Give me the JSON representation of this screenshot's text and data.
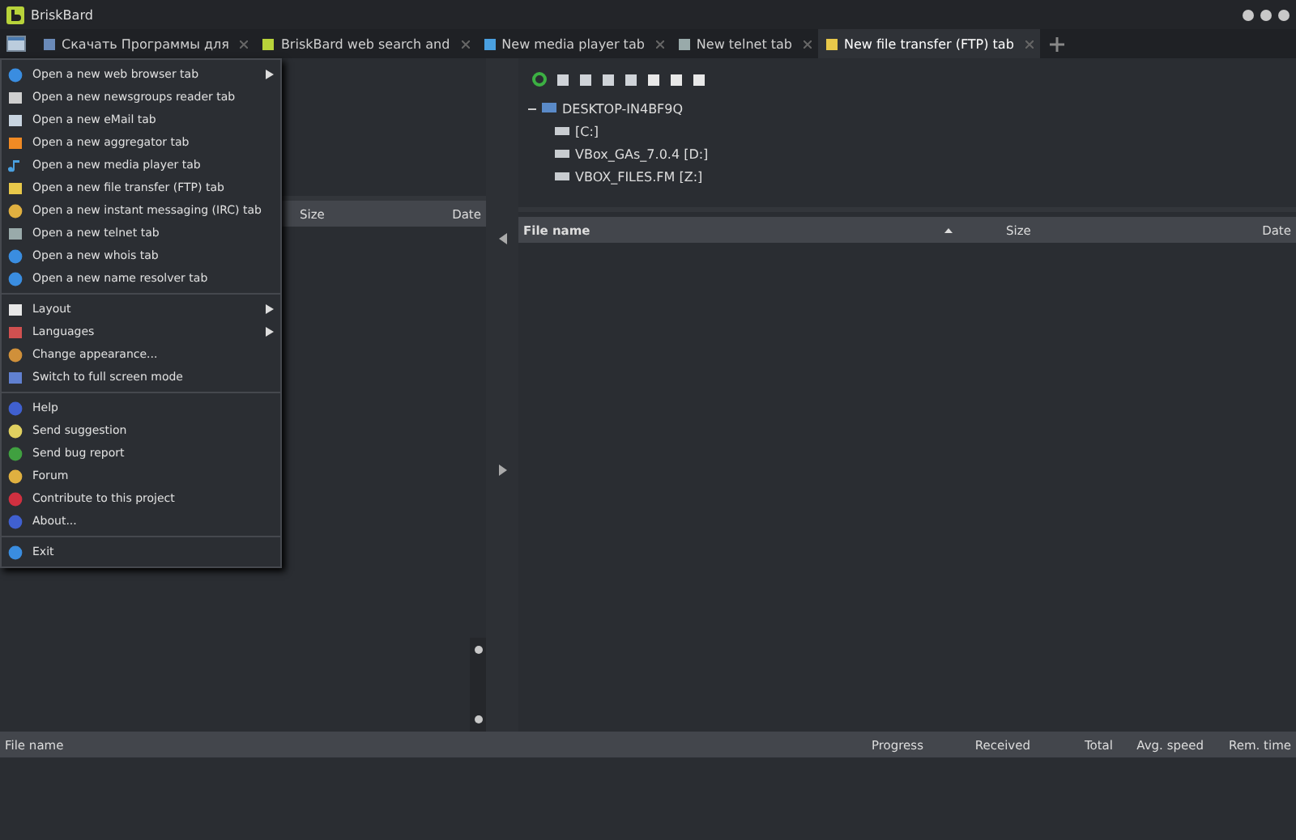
{
  "window": {
    "title": "BriskBard"
  },
  "tabs": [
    {
      "label": "Скачать Программы для",
      "selected": false
    },
    {
      "label": "BriskBard web search and",
      "selected": false
    },
    {
      "label": "New media player tab",
      "selected": false
    },
    {
      "label": "New telnet tab",
      "selected": false
    },
    {
      "label": "New file transfer (FTP) tab",
      "selected": true
    }
  ],
  "menu": {
    "items": [
      {
        "kind": "item",
        "label": "Open a new web browser tab",
        "submenu": true
      },
      {
        "kind": "item",
        "label": "Open a new newsgroups reader tab",
        "submenu": false
      },
      {
        "kind": "item",
        "label": "Open a new eMail tab",
        "submenu": false
      },
      {
        "kind": "item",
        "label": "Open a new aggregator tab",
        "submenu": false
      },
      {
        "kind": "item",
        "label": "Open a new media player tab",
        "submenu": false
      },
      {
        "kind": "item",
        "label": "Open a new file transfer (FTP) tab",
        "submenu": false
      },
      {
        "kind": "item",
        "label": "Open a new instant messaging (IRC) tab",
        "submenu": false
      },
      {
        "kind": "item",
        "label": "Open a new telnet tab",
        "submenu": false
      },
      {
        "kind": "item",
        "label": "Open a new whois tab",
        "submenu": false
      },
      {
        "kind": "item",
        "label": "Open a new name resolver tab",
        "submenu": false
      },
      {
        "kind": "separator"
      },
      {
        "kind": "item",
        "label": "Layout",
        "submenu": true
      },
      {
        "kind": "item",
        "label": "Languages",
        "submenu": true
      },
      {
        "kind": "item",
        "label": "Change appearance...",
        "submenu": false
      },
      {
        "kind": "item",
        "label": "Switch to full screen mode",
        "submenu": false
      },
      {
        "kind": "separator"
      },
      {
        "kind": "item",
        "label": "Help",
        "submenu": false
      },
      {
        "kind": "item",
        "label": "Send suggestion",
        "submenu": false
      },
      {
        "kind": "item",
        "label": "Send bug report",
        "submenu": false
      },
      {
        "kind": "item",
        "label": "Forum",
        "submenu": false
      },
      {
        "kind": "item",
        "label": "Contribute to this project",
        "submenu": false
      },
      {
        "kind": "item",
        "label": "About...",
        "submenu": false
      },
      {
        "kind": "separator"
      },
      {
        "kind": "item",
        "label": "Exit",
        "submenu": false
      }
    ]
  },
  "local_list": {
    "columns": [
      "Size",
      "Date"
    ]
  },
  "remote_tree": {
    "label": "DESKTOP-IN4BF9Q",
    "expanded": true,
    "children": [
      {
        "label": "[C:]"
      },
      {
        "label": "VBox_GAs_7.0.4 [D:]"
      },
      {
        "label": "VBOX_FILES.FM [Z:]"
      }
    ]
  },
  "remote_list": {
    "columns": [
      {
        "label": "File name",
        "sorted": true
      },
      {
        "label": "Size",
        "sorted": false
      },
      {
        "label": "Date",
        "sorted": false
      }
    ]
  },
  "transfers": {
    "columns": [
      "File name",
      "Progress",
      "Received",
      "Total",
      "Avg. speed",
      "Rem. time"
    ]
  }
}
